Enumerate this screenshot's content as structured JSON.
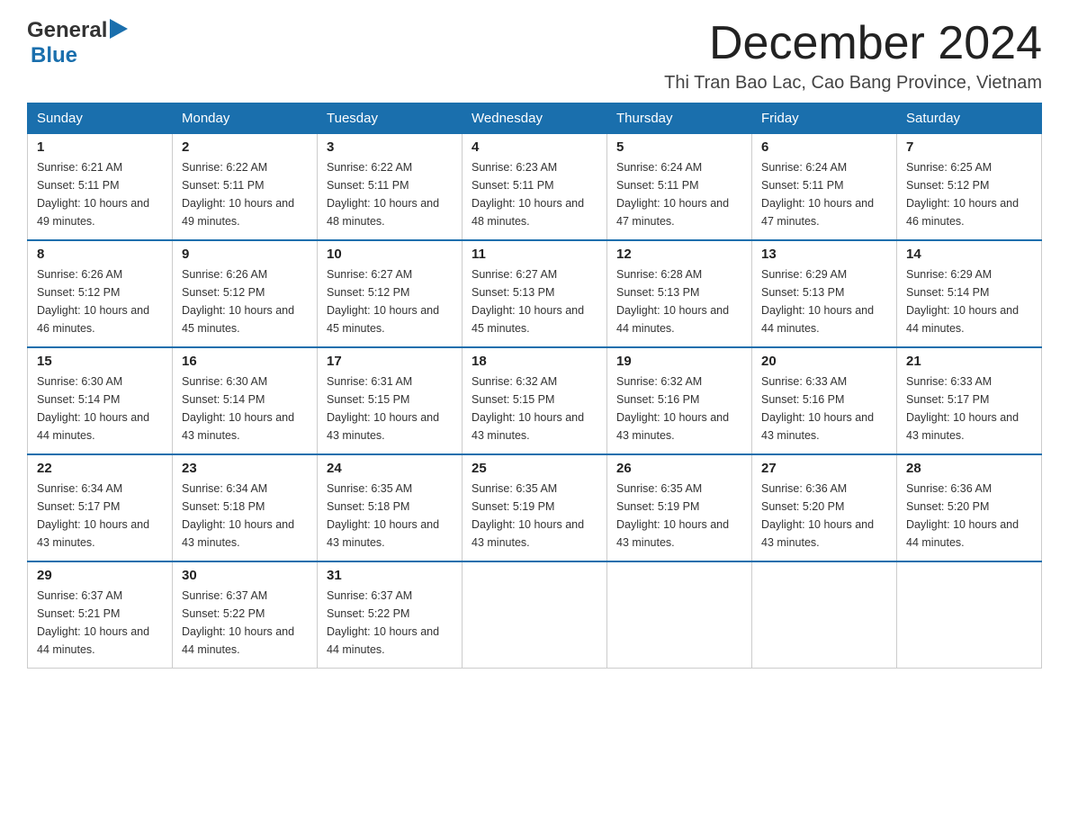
{
  "header": {
    "logo_general": "General",
    "logo_blue": "Blue",
    "month_title": "December 2024",
    "subtitle": "Thi Tran Bao Lac, Cao Bang Province, Vietnam"
  },
  "calendar": {
    "days_of_week": [
      "Sunday",
      "Monday",
      "Tuesday",
      "Wednesday",
      "Thursday",
      "Friday",
      "Saturday"
    ],
    "weeks": [
      [
        {
          "day": "1",
          "sunrise": "6:21 AM",
          "sunset": "5:11 PM",
          "daylight": "10 hours and 49 minutes."
        },
        {
          "day": "2",
          "sunrise": "6:22 AM",
          "sunset": "5:11 PM",
          "daylight": "10 hours and 49 minutes."
        },
        {
          "day": "3",
          "sunrise": "6:22 AM",
          "sunset": "5:11 PM",
          "daylight": "10 hours and 48 minutes."
        },
        {
          "day": "4",
          "sunrise": "6:23 AM",
          "sunset": "5:11 PM",
          "daylight": "10 hours and 48 minutes."
        },
        {
          "day": "5",
          "sunrise": "6:24 AM",
          "sunset": "5:11 PM",
          "daylight": "10 hours and 47 minutes."
        },
        {
          "day": "6",
          "sunrise": "6:24 AM",
          "sunset": "5:11 PM",
          "daylight": "10 hours and 47 minutes."
        },
        {
          "day": "7",
          "sunrise": "6:25 AM",
          "sunset": "5:12 PM",
          "daylight": "10 hours and 46 minutes."
        }
      ],
      [
        {
          "day": "8",
          "sunrise": "6:26 AM",
          "sunset": "5:12 PM",
          "daylight": "10 hours and 46 minutes."
        },
        {
          "day": "9",
          "sunrise": "6:26 AM",
          "sunset": "5:12 PM",
          "daylight": "10 hours and 45 minutes."
        },
        {
          "day": "10",
          "sunrise": "6:27 AM",
          "sunset": "5:12 PM",
          "daylight": "10 hours and 45 minutes."
        },
        {
          "day": "11",
          "sunrise": "6:27 AM",
          "sunset": "5:13 PM",
          "daylight": "10 hours and 45 minutes."
        },
        {
          "day": "12",
          "sunrise": "6:28 AM",
          "sunset": "5:13 PM",
          "daylight": "10 hours and 44 minutes."
        },
        {
          "day": "13",
          "sunrise": "6:29 AM",
          "sunset": "5:13 PM",
          "daylight": "10 hours and 44 minutes."
        },
        {
          "day": "14",
          "sunrise": "6:29 AM",
          "sunset": "5:14 PM",
          "daylight": "10 hours and 44 minutes."
        }
      ],
      [
        {
          "day": "15",
          "sunrise": "6:30 AM",
          "sunset": "5:14 PM",
          "daylight": "10 hours and 44 minutes."
        },
        {
          "day": "16",
          "sunrise": "6:30 AM",
          "sunset": "5:14 PM",
          "daylight": "10 hours and 43 minutes."
        },
        {
          "day": "17",
          "sunrise": "6:31 AM",
          "sunset": "5:15 PM",
          "daylight": "10 hours and 43 minutes."
        },
        {
          "day": "18",
          "sunrise": "6:32 AM",
          "sunset": "5:15 PM",
          "daylight": "10 hours and 43 minutes."
        },
        {
          "day": "19",
          "sunrise": "6:32 AM",
          "sunset": "5:16 PM",
          "daylight": "10 hours and 43 minutes."
        },
        {
          "day": "20",
          "sunrise": "6:33 AM",
          "sunset": "5:16 PM",
          "daylight": "10 hours and 43 minutes."
        },
        {
          "day": "21",
          "sunrise": "6:33 AM",
          "sunset": "5:17 PM",
          "daylight": "10 hours and 43 minutes."
        }
      ],
      [
        {
          "day": "22",
          "sunrise": "6:34 AM",
          "sunset": "5:17 PM",
          "daylight": "10 hours and 43 minutes."
        },
        {
          "day": "23",
          "sunrise": "6:34 AM",
          "sunset": "5:18 PM",
          "daylight": "10 hours and 43 minutes."
        },
        {
          "day": "24",
          "sunrise": "6:35 AM",
          "sunset": "5:18 PM",
          "daylight": "10 hours and 43 minutes."
        },
        {
          "day": "25",
          "sunrise": "6:35 AM",
          "sunset": "5:19 PM",
          "daylight": "10 hours and 43 minutes."
        },
        {
          "day": "26",
          "sunrise": "6:35 AM",
          "sunset": "5:19 PM",
          "daylight": "10 hours and 43 minutes."
        },
        {
          "day": "27",
          "sunrise": "6:36 AM",
          "sunset": "5:20 PM",
          "daylight": "10 hours and 43 minutes."
        },
        {
          "day": "28",
          "sunrise": "6:36 AM",
          "sunset": "5:20 PM",
          "daylight": "10 hours and 44 minutes."
        }
      ],
      [
        {
          "day": "29",
          "sunrise": "6:37 AM",
          "sunset": "5:21 PM",
          "daylight": "10 hours and 44 minutes."
        },
        {
          "day": "30",
          "sunrise": "6:37 AM",
          "sunset": "5:22 PM",
          "daylight": "10 hours and 44 minutes."
        },
        {
          "day": "31",
          "sunrise": "6:37 AM",
          "sunset": "5:22 PM",
          "daylight": "10 hours and 44 minutes."
        },
        null,
        null,
        null,
        null
      ]
    ],
    "labels": {
      "sunrise": "Sunrise:",
      "sunset": "Sunset:",
      "daylight": "Daylight:"
    }
  }
}
